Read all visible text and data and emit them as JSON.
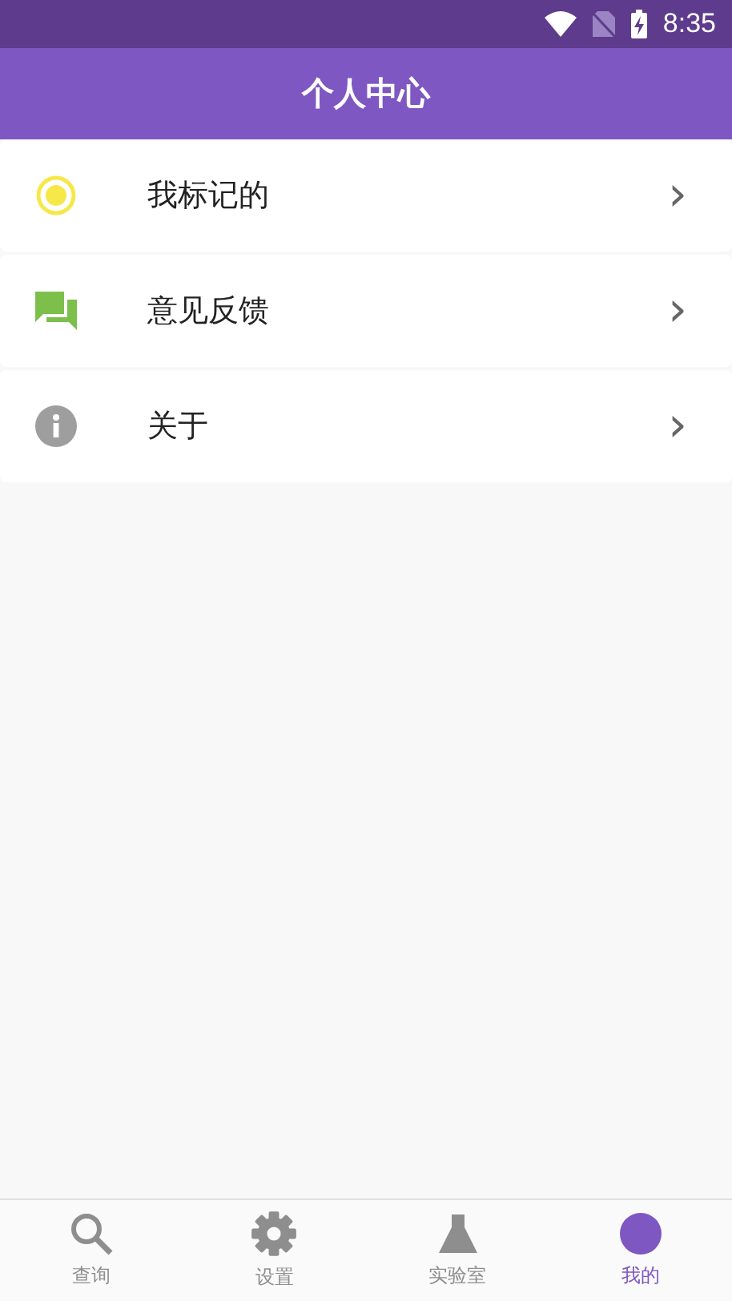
{
  "status_bar": {
    "time": "8:35"
  },
  "header": {
    "title": "个人中心"
  },
  "menu": [
    {
      "label": "我标记的",
      "chevron": "›"
    },
    {
      "label": "意见反馈",
      "chevron": "›"
    },
    {
      "label": "关于",
      "chevron": "›"
    }
  ],
  "tabs": [
    {
      "label": "查询",
      "selected": false
    },
    {
      "label": "设置",
      "selected": false
    },
    {
      "label": "实验室",
      "selected": false
    },
    {
      "label": "我的",
      "selected": true
    }
  ]
}
